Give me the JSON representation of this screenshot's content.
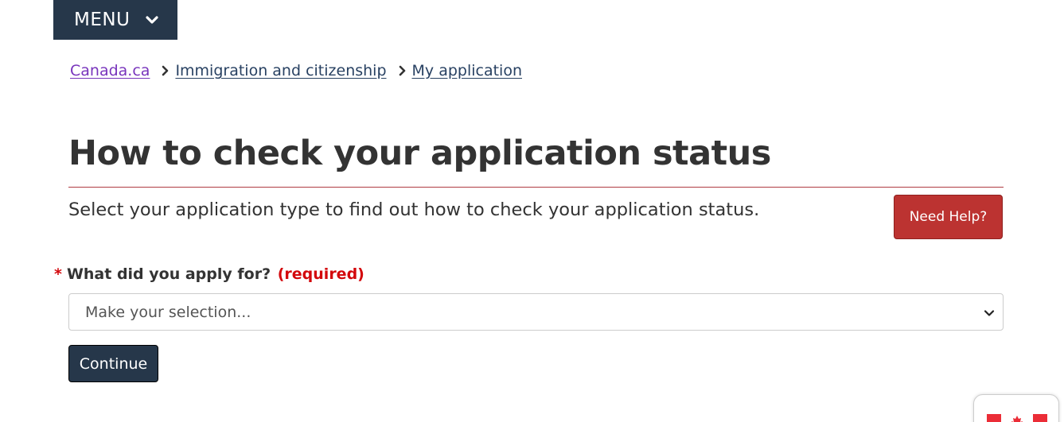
{
  "menu": {
    "label": "MENU"
  },
  "breadcrumb": [
    {
      "label": "Canada.ca"
    },
    {
      "label": "Immigration and citizenship"
    },
    {
      "label": "My application"
    }
  ],
  "page": {
    "title": "How to check your application status",
    "lead": "Select your application type to find out how to check your application status."
  },
  "help_button": {
    "label": "Need Help?"
  },
  "form": {
    "required_marker": "*",
    "label": "What did you apply for?",
    "required_text": "(required)",
    "select_value": "Make your selection...",
    "continue_label": "Continue"
  },
  "colors": {
    "nav_dark": "#26374a",
    "link": "#284162",
    "visited_link": "#7834bc",
    "title_rule": "#af3c43",
    "help_red": "#bc3331",
    "required_red": "#d3080c",
    "flag_red": "#eb2d37"
  },
  "icons": {
    "menu": "chevron-down-icon",
    "breadcrumb_separator": "chevron-right-icon",
    "select": "chevron-down-icon",
    "corner_widget": "canada-flag-icon"
  }
}
